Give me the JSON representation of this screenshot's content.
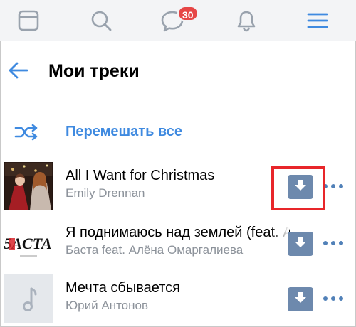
{
  "tabbar": {
    "tabs": [
      {
        "name": "news",
        "icon": "news-feed-icon"
      },
      {
        "name": "search",
        "icon": "search-icon"
      },
      {
        "name": "messages",
        "icon": "messages-icon"
      },
      {
        "name": "notifications",
        "icon": "bell-icon"
      },
      {
        "name": "menu",
        "icon": "menu-icon"
      }
    ],
    "messages_badge": "30"
  },
  "header": {
    "back_icon": "arrow-left-icon",
    "title": "Мои треки"
  },
  "shuffle": {
    "icon": "shuffle-icon",
    "label": "Перемешать все"
  },
  "tracks": [
    {
      "title": "All I Want for Christmas",
      "artist": "Emily Drennan",
      "cover": "album-cover-christmas",
      "download_icon": "download-icon",
      "more_icon": "more-horizontal-icon",
      "highlighted": true
    },
    {
      "title": "Я поднимаюсь над землей (feat. А",
      "artist": "Баста feat. Алёна Омаргалиева",
      "cover": "album-cover-basta",
      "cover_text": "5ACTA",
      "download_icon": "download-icon",
      "more_icon": "more-horizontal-icon",
      "highlighted": false
    },
    {
      "title": "Мечта сбывается",
      "artist": "Юрий Антонов",
      "cover": "music-note-placeholder-icon",
      "download_icon": "download-icon",
      "more_icon": "more-horizontal-icon",
      "highlighted": false
    }
  ],
  "colors": {
    "accent": "#3f8ae0",
    "badge": "#e64646",
    "download_button": "#6d89ad",
    "icon_grey": "#99a2ad",
    "highlight_frame": "#e8262a",
    "secondary_text": "#8c929a"
  }
}
